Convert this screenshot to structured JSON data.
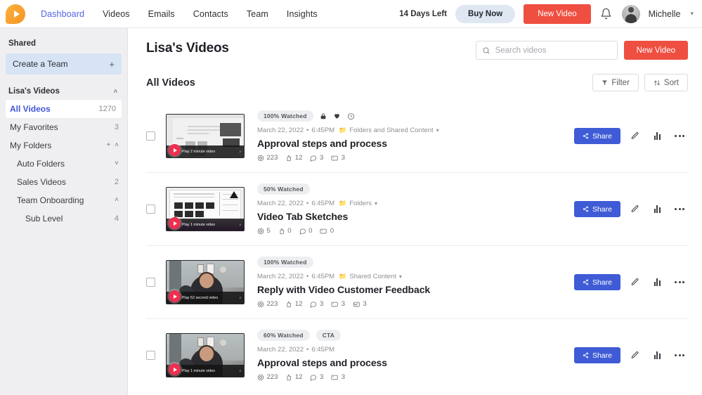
{
  "topnav": {
    "logo_icon": "play-logo-icon",
    "links": [
      {
        "label": "Dashboard",
        "active": true
      },
      {
        "label": "Videos",
        "active": false
      },
      {
        "label": "Emails",
        "active": false
      },
      {
        "label": "Contacts",
        "active": false
      },
      {
        "label": "Team",
        "active": false
      },
      {
        "label": "Insights",
        "active": false
      }
    ],
    "days_left": "14 Days Left",
    "buy_now": "Buy Now",
    "new_video": "New Video",
    "bell_icon": "bell-icon",
    "username": "Michelle",
    "caret": "⌄"
  },
  "sidebar": {
    "shared_title": "Shared",
    "create_team": {
      "label": "Create a Team",
      "plus": "+"
    },
    "group_title": "Lisa's Videos",
    "group_caret": "˄",
    "items": [
      {
        "label": "All Videos",
        "count": "1270",
        "active": true,
        "indent": 0,
        "icons": []
      },
      {
        "label": "My Favorites",
        "count": "3",
        "active": false,
        "indent": 0,
        "icons": []
      },
      {
        "label": "My Folders",
        "count": "",
        "active": false,
        "indent": 0,
        "icons": [
          "+",
          "˄"
        ]
      },
      {
        "label": "Auto Folders",
        "count": "",
        "active": false,
        "indent": 1,
        "icons": [
          "˅"
        ]
      },
      {
        "label": "Sales Videos",
        "count": "2",
        "active": false,
        "indent": 1,
        "icons": []
      },
      {
        "label": "Team Onboarding",
        "count": "",
        "active": false,
        "indent": 1,
        "icons": [
          "˄"
        ]
      },
      {
        "label": "Sub Level",
        "count": "4",
        "active": false,
        "indent": 2,
        "icons": []
      }
    ]
  },
  "main": {
    "page_title": "Lisa's Videos",
    "search_placeholder": "Search videos",
    "search_value": "",
    "new_video": "New Video",
    "subtitle": "All Videos",
    "filter": "Filter",
    "sort": "Sort"
  },
  "videos": [
    {
      "watched": "100% Watched",
      "tag": "",
      "badge_icons": [
        "lock-icon",
        "heart-icon",
        "clock-icon"
      ],
      "date": "March 22, 2022",
      "time": "6:45PM",
      "folder": "Folders and Shared Content",
      "has_folder": true,
      "title": "Approval steps and process",
      "stats": [
        {
          "icon": "views-icon",
          "value": "223"
        },
        {
          "icon": "thumbs-up-icon",
          "value": "12"
        },
        {
          "icon": "comment-icon",
          "value": "3"
        },
        {
          "icon": "cta-icon",
          "value": "3"
        }
      ],
      "thumb_caption": "Play 2 minute video",
      "thumb_style": "doc",
      "share": "Share"
    },
    {
      "watched": "50% Watched",
      "tag": "",
      "badge_icons": [],
      "date": "March 22, 2022",
      "time": "6:45PM",
      "folder": "Folders",
      "has_folder": true,
      "title": "Video Tab Sketches",
      "stats": [
        {
          "icon": "views-icon",
          "value": "5"
        },
        {
          "icon": "thumbs-up-icon",
          "value": "0"
        },
        {
          "icon": "comment-icon",
          "value": "0"
        },
        {
          "icon": "cta-icon",
          "value": "0"
        }
      ],
      "thumb_caption": "Play 1 minute video",
      "thumb_style": "purple",
      "share": "Share"
    },
    {
      "watched": "100% Watched",
      "tag": "",
      "badge_icons": [],
      "date": "March 22, 2022",
      "time": "6:45PM",
      "folder": "Shared Content",
      "has_folder": true,
      "title": "Reply with Video Customer Feedback",
      "stats": [
        {
          "icon": "views-icon",
          "value": "223"
        },
        {
          "icon": "thumbs-up-icon",
          "value": "12"
        },
        {
          "icon": "comment-icon",
          "value": "3"
        },
        {
          "icon": "cta-icon",
          "value": "3"
        },
        {
          "icon": "reply-icon",
          "value": "3"
        }
      ],
      "thumb_caption": "Play 52 second video",
      "thumb_style": "room",
      "share": "Share"
    },
    {
      "watched": "60% Watched",
      "tag": "CTA",
      "badge_icons": [],
      "date": "March 22, 2022",
      "time": "6:45PM",
      "folder": "",
      "has_folder": false,
      "title": "Approval steps and process",
      "stats": [
        {
          "icon": "views-icon",
          "value": "223"
        },
        {
          "icon": "thumbs-up-icon",
          "value": "12"
        },
        {
          "icon": "comment-icon",
          "value": "3"
        },
        {
          "icon": "cta-icon",
          "value": "3"
        }
      ],
      "thumb_caption": "Play 1 minute video",
      "thumb_style": "room",
      "share": "Share"
    }
  ],
  "colors": {
    "accent_red": "#ef4f40",
    "accent_blue": "#3f5cd6",
    "link_blue": "#5063e8",
    "sidebar_bg": "#efeff1",
    "logo_orange": "#f5a623",
    "play_red": "#ef2f4f",
    "buy_now_bg": "#dfe7f3",
    "create_team_bg": "#d6e4f5"
  }
}
